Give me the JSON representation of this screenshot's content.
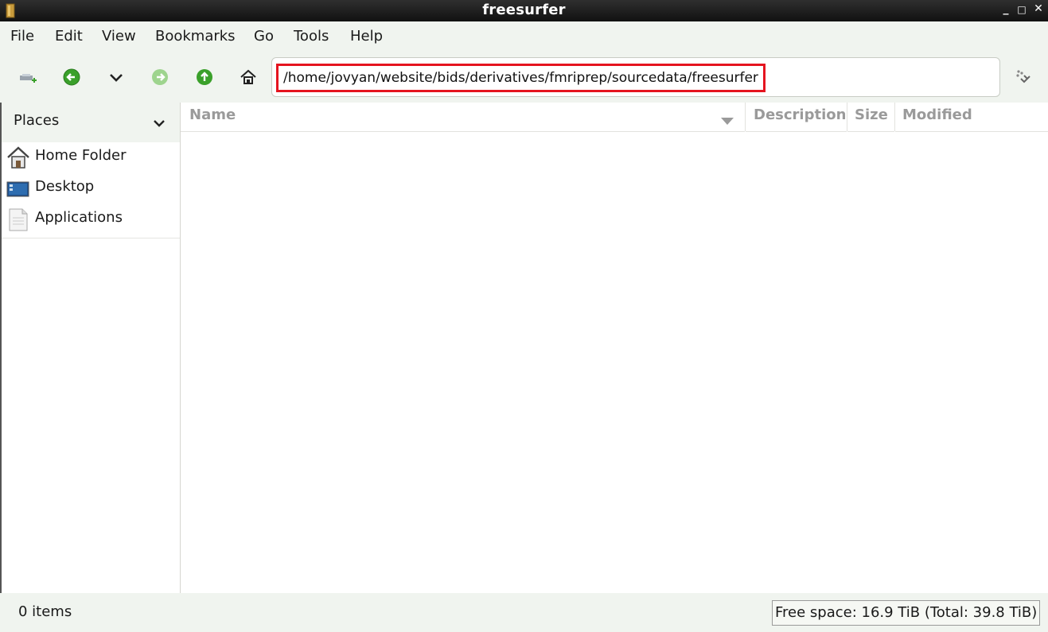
{
  "window": {
    "title": "freesurfer",
    "minimize_label": "_",
    "maximize_label": "□",
    "close_label": "✕"
  },
  "menubar": {
    "items": [
      "File",
      "Edit",
      "View",
      "Bookmarks",
      "Go",
      "Tools",
      "Help"
    ]
  },
  "toolbar": {
    "buttons": [
      "new-tab-icon",
      "back-icon",
      "history-dropdown-icon",
      "forward-icon",
      "up-icon",
      "home-icon"
    ],
    "location_path": "/home/jovyan/website/bids/derivatives/fmriprep/sourcedata/freesurfer",
    "jump_icon": "go-icon"
  },
  "sidebar": {
    "header": "Places",
    "items": [
      {
        "label": "Home Folder",
        "icon": "home-folder-icon"
      },
      {
        "label": "Desktop",
        "icon": "desktop-icon"
      },
      {
        "label": "Applications",
        "icon": "applications-icon"
      }
    ]
  },
  "listview": {
    "columns": [
      "Name",
      "Description",
      "Size",
      "Modified"
    ],
    "rows": []
  },
  "statusbar": {
    "item_count": "0 items",
    "free_space": "Free space: 16.9 TiB (Total: 39.8 TiB)"
  },
  "colors": {
    "highlight_border": "#e5141f",
    "green_accent": "#3aa02a",
    "titlebar": "#1b1b1b"
  }
}
